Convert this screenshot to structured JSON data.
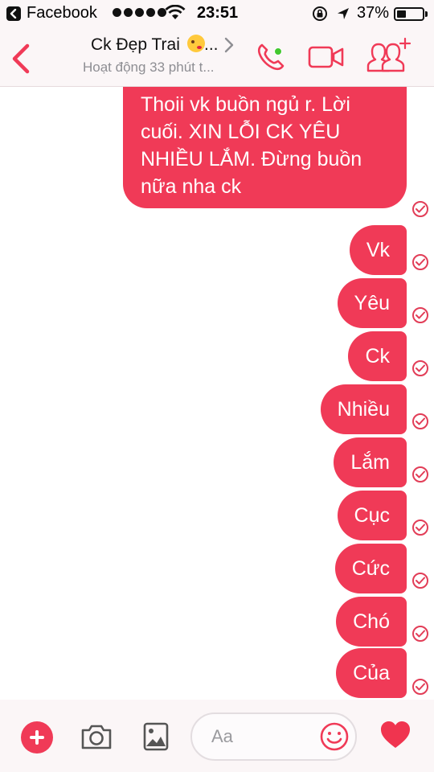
{
  "status_bar": {
    "back_app": "Facebook",
    "time": "23:51",
    "battery": "37%",
    "battery_level": 0.37
  },
  "header": {
    "contact_name": "Ck Đẹp Trai",
    "contact_emoji": "kissing-face-emoji",
    "name_ellipsis": "...",
    "subtitle": "Hoạt động 33 phút t...",
    "online": true
  },
  "messages": [
    {
      "text": "Thoii vk buồn ngủ r. Lời cuối. XIN LỖI CK YÊU NHIỀU LẮM. Đừng buồn nữa nha ck",
      "from": "me",
      "status": "sent"
    },
    {
      "text": "Vk",
      "from": "me",
      "status": "sent"
    },
    {
      "text": "Yêu",
      "from": "me",
      "status": "sent"
    },
    {
      "text": "Ck",
      "from": "me",
      "status": "sent"
    },
    {
      "text": "Nhiều",
      "from": "me",
      "status": "sent"
    },
    {
      "text": "Lắm",
      "from": "me",
      "status": "sent"
    },
    {
      "text": "Cục",
      "from": "me",
      "status": "sent"
    },
    {
      "text": "Cức",
      "from": "me",
      "status": "sent"
    },
    {
      "text": "Chó",
      "from": "me",
      "status": "sent"
    },
    {
      "text": "Của",
      "from": "me",
      "status": "sent"
    }
  ],
  "composer": {
    "placeholder": "Aa"
  },
  "colors": {
    "accent": "#f03a57",
    "online": "#42c72f",
    "header_bg": "#fbf6f7"
  },
  "icons": [
    "back-app-icon",
    "signal-dots-icon",
    "wifi-icon",
    "rotation-lock-icon",
    "location-arrow-icon",
    "battery-icon",
    "back-chevron-icon",
    "phone-icon",
    "video-camera-icon",
    "add-people-icon",
    "plus-icon",
    "camera-icon",
    "photo-icon",
    "smile-icon",
    "heart-icon",
    "read-receipt-icon"
  ]
}
